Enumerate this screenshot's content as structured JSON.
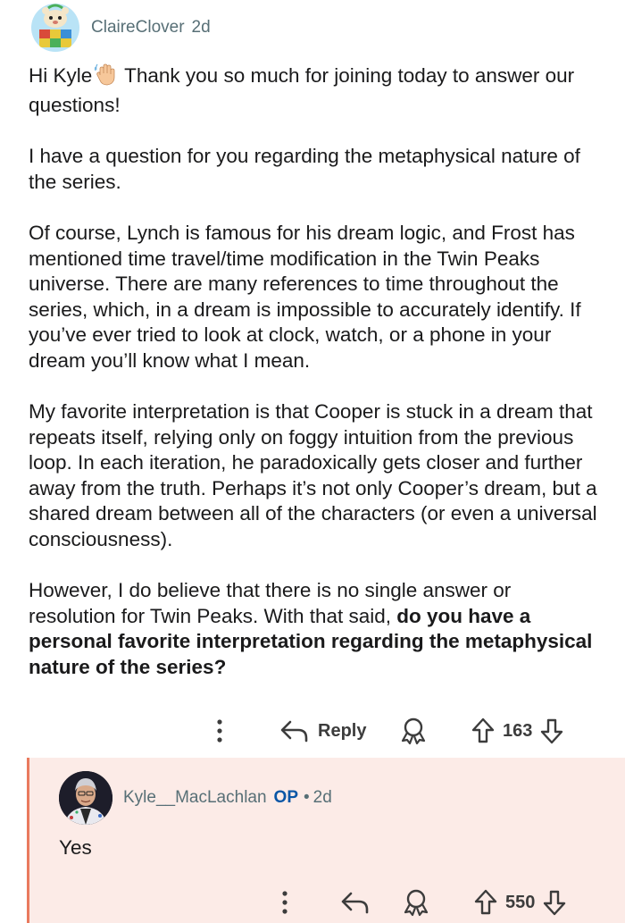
{
  "comment": {
    "author": "ClaireClover",
    "age": "2d",
    "paragraphs": [
      {
        "text_before": "Hi Kyle",
        "emoji": "waving-hand",
        "text_after": " Thank you so much for joining today to answer our questions!"
      },
      {
        "text": "I have a question for you regarding the metaphysical nature of the series."
      },
      {
        "text": "Of course, Lynch is famous for his dream logic, and Frost has mentioned time travel/time modification in the Twin Peaks universe. There are many references to time throughout the series, which, in a dream is impossible to accurately identify. If you’ve ever tried to look at clock, watch, or a phone in your dream you’ll know what I mean."
      },
      {
        "text": "My favorite interpretation is that Cooper is stuck in a dream that repeats itself, relying only on foggy intuition from the previous loop. In each iteration, he paradoxically gets closer and further away from the truth. Perhaps it’s not only Cooper’s dream, but a shared dream between all of the characters (or even a universal consciousness)."
      },
      {
        "text_plain": "However, I do believe that there is no single answer or resolution for Twin Peaks. With that said, ",
        "text_bold": "do you have a personal favorite interpretation regarding the metaphysical nature of the series?"
      }
    ],
    "actions": {
      "reply_label": "Reply",
      "vote_count": "163"
    }
  },
  "reply": {
    "author": "Kyle__MacLachlan",
    "badge": "OP",
    "separator": "•",
    "age": "2d",
    "text": "Yes",
    "vote_count": "550"
  },
  "colors": {
    "reply_background": "#fcebe7",
    "reply_border": "#e97a5e",
    "op_badge": "#0a56a6",
    "meta_text": "#576f76"
  },
  "icons": [
    "snoo-avatar",
    "waving-hand-emoji",
    "more-options-icon",
    "reply-arrow-icon",
    "award-icon",
    "upvote-icon",
    "downvote-icon",
    "user-photo-avatar"
  ]
}
